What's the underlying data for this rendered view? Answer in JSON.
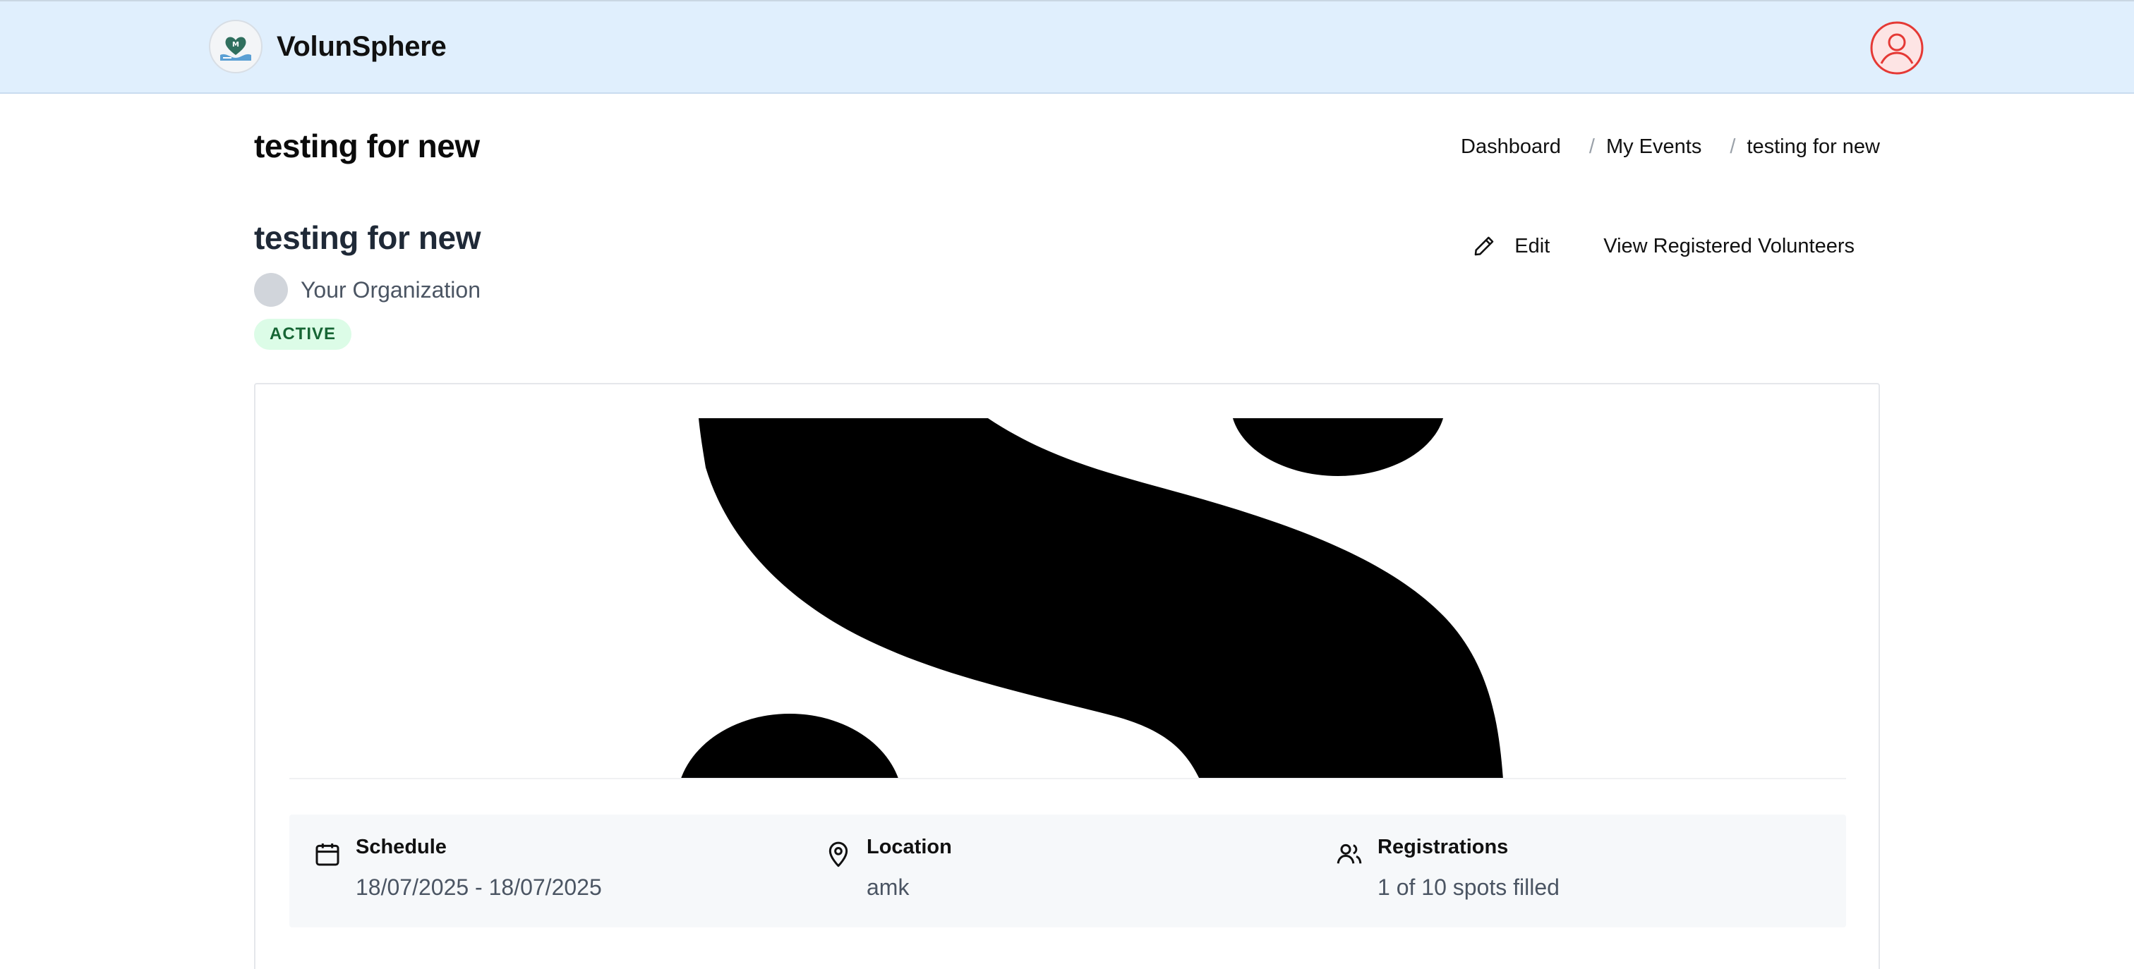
{
  "header": {
    "brand_name": "VolunSphere",
    "logo_icon": "heart-hands-logo",
    "profile_icon": "user-circle-icon",
    "accent": "#e0effd",
    "profile_color": "#e53935"
  },
  "page": {
    "title": "testing for new",
    "breadcrumb": [
      "Dashboard",
      "My Events",
      "testing for new"
    ]
  },
  "event": {
    "title": "testing for new",
    "organization": "Your Organization",
    "status": "ACTIVE",
    "status_color": "#166534",
    "actions": {
      "edit_label": "Edit",
      "edit_icon": "pencil-icon",
      "view_label": "View Registered Volunteers"
    },
    "banner_image": "black-s-logo"
  },
  "details": {
    "schedule": {
      "label": "Schedule",
      "value": "18/07/2025 - 18/07/2025",
      "icon": "calendar-icon"
    },
    "location": {
      "label": "Location",
      "value": "amk",
      "icon": "map-pin-icon"
    },
    "registrations": {
      "label": "Registrations",
      "value": "1 of 10 spots filled",
      "icon": "users-icon"
    }
  }
}
